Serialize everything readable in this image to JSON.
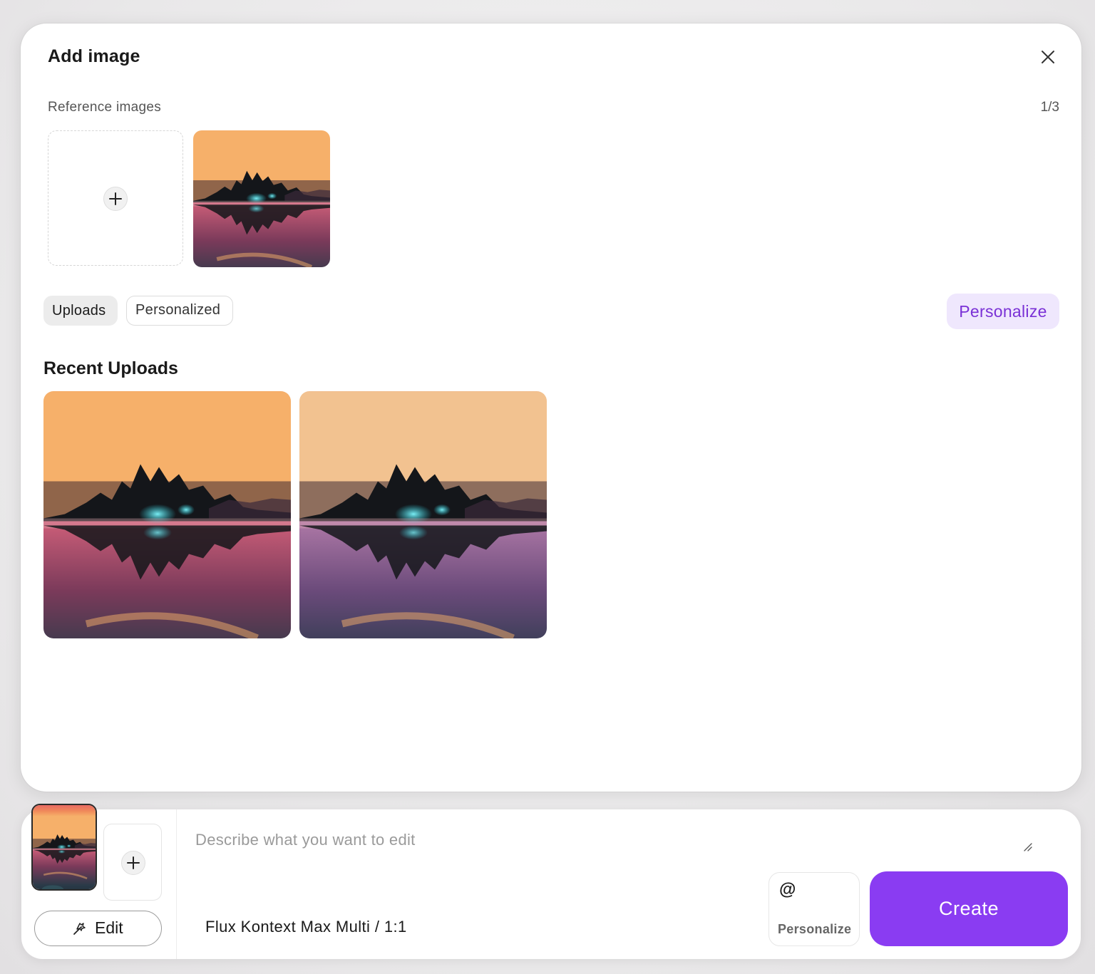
{
  "modal": {
    "title": "Add image",
    "reference_label": "Reference images",
    "reference_count": "1/3",
    "tabs": [
      {
        "label": "Uploads",
        "active": true
      },
      {
        "label": "Personalized",
        "active": false
      }
    ],
    "personalize_label": "Personalize",
    "recent_heading": "Recent Uploads",
    "recent_count": 2
  },
  "composer": {
    "prompt_placeholder": "Describe what you want to edit",
    "prompt_value": "",
    "edit_label": "Edit",
    "model_label": "Flux Kontext Max Multi / 1:1",
    "mention_symbol": "@",
    "mention_label": "Personalize",
    "create_label": "Create"
  },
  "colors": {
    "accent": "#8a3cf2",
    "accent_soft_bg": "#efe7fd",
    "accent_soft_text": "#7a31d6"
  }
}
